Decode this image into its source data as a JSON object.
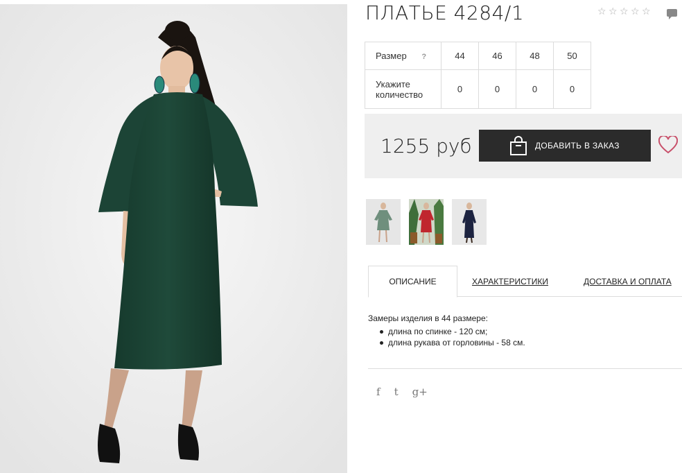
{
  "product": {
    "title": "ПЛАТЬЕ 4284/1",
    "rating": 0,
    "rating_max": 5
  },
  "size_table": {
    "size_label": "Размер",
    "help": "?",
    "sizes": [
      "44",
      "46",
      "48",
      "50"
    ],
    "qty_label_line1": "Укажите",
    "qty_label_line2": "количество",
    "quantities": [
      "0",
      "0",
      "0",
      "0"
    ]
  },
  "price": {
    "amount": "1255 руб",
    "add_button": "ДОБАВИТЬ В ЗАКАЗ"
  },
  "thumbnails": [
    "green-dress",
    "red-dress",
    "navy-dress"
  ],
  "tabs": {
    "description": "ОПИСАНИЕ",
    "characteristics": "ХАРАКТЕРИСТИКИ",
    "delivery": "ДОСТАВКА И ОПЛАТА"
  },
  "description": {
    "intro": "Замеры изделия в 44 размере:",
    "items": [
      "длина по спинке - 120 см;",
      "длина рукава от горловины - 58 см."
    ]
  },
  "social": {
    "facebook": "f",
    "twitter": "t",
    "google": "g+"
  },
  "colors": {
    "dress_green": "#1f4a3a",
    "button_bg": "#2b2b2b",
    "heart": "#c8506a",
    "price_bg": "#efefef"
  }
}
